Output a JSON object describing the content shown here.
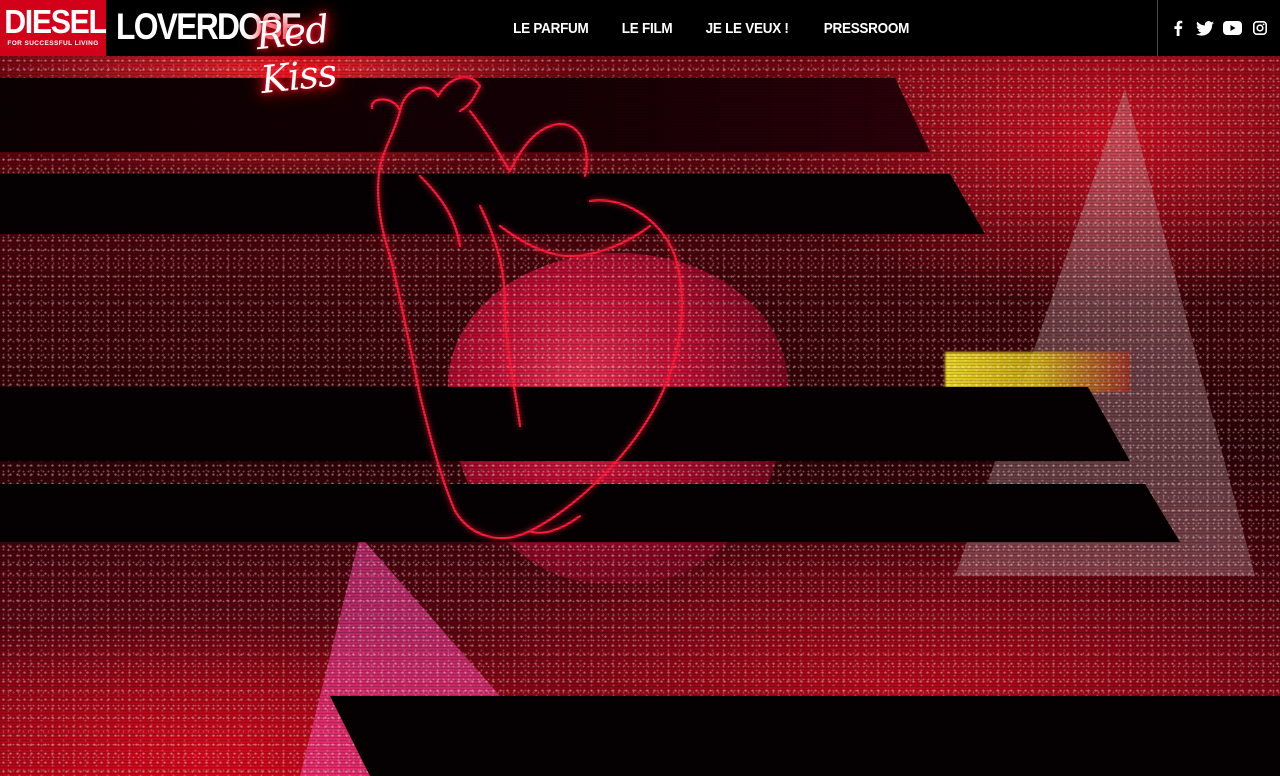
{
  "header": {
    "diesel_logo": {
      "word": "DIESEL",
      "tagline": "FOR SUCCESSFUL LIVING"
    },
    "brand": {
      "name": "LOVERDOSE",
      "script": "Red Kiss"
    },
    "nav": [
      {
        "label": "LE PARFUM"
      },
      {
        "label": "LE FILM"
      },
      {
        "label": "JE LE VEUX !"
      },
      {
        "label": "PRESSROOM"
      }
    ],
    "social": [
      {
        "icon": "facebook-icon"
      },
      {
        "icon": "twitter-icon"
      },
      {
        "icon": "youtube-icon"
      },
      {
        "icon": "instagram-icon"
      }
    ]
  },
  "hero": {
    "description_colors": {
      "accent": "#d3001a",
      "neon": "#ff1a2e",
      "glow_yellow": "#f0dc28"
    }
  }
}
